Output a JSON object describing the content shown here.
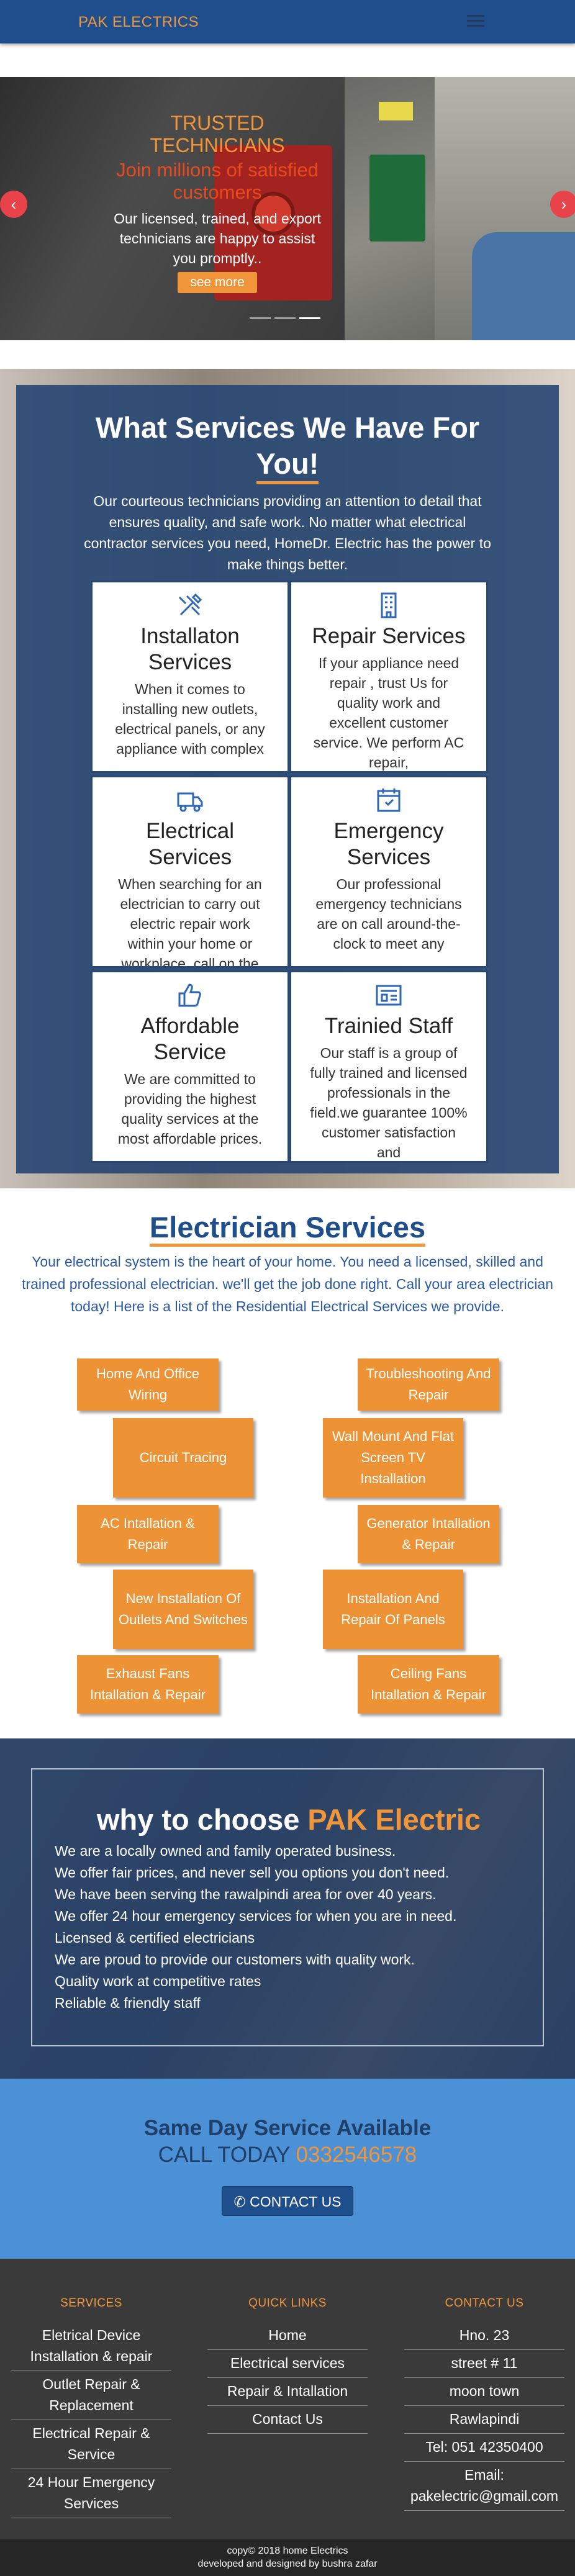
{
  "navbar": {
    "brand": "PAK ELECTRICS"
  },
  "hero": {
    "title": "TRUSTED TECHNICIANS",
    "subtitle": "Join millions of satisfied customers",
    "text": "Our licensed, trained, and export technicians are happy to assist you promptly..",
    "button": "see more",
    "arrow_left": "‹",
    "arrow_right": "›",
    "slides_count": 3,
    "active_slide": 3
  },
  "services": {
    "title_line1": "What Services We Have For",
    "title_line2": "You!",
    "description": "Our courteous technicians providing an attention to detail that ensures quality, and safe work. No matter what electrical contractor services you need, HomeDr. Electric has the power to make things better.",
    "cards": [
      {
        "icon": "hammer-wrench-icon",
        "title": "Installaton Services",
        "text": "When it comes to installing new outlets, electrical panels, or any appliance with complex"
      },
      {
        "icon": "building-icon",
        "title": "Repair Services",
        "text": "If your appliance need repair , trust Us for quality work and excellent customer service. We perform AC repair,"
      },
      {
        "icon": "truck-icon",
        "title": "Electrical Services",
        "text": "When searching for an electrician to carry out electric repair work within your home or workplace, call on the trusted"
      },
      {
        "icon": "calendar-icon",
        "title": "Emergency Services",
        "text": "Our professional emergency technicians are on call around-the-clock to meet any"
      },
      {
        "icon": "thumbs-up-icon",
        "title": "Affordable Service",
        "text": "We are committed to providing the highest quality services at the most affordable prices."
      },
      {
        "icon": "id-card-icon",
        "title": "Trainied Staff",
        "text": "Our staff is a group of fully trained and licensed professionals in the field.we guarantee 100% customer satisfaction and"
      }
    ]
  },
  "electrician": {
    "title": "Electrician Services",
    "description": "Your electrical system is the heart of your home. You need a licensed, skilled and trained professional electrician. we'll get the job done right. Call your area electrician today! Here is a list of the Residential Electrical Services we provide.",
    "buttons": [
      "Home And Office Wiring",
      "Troubleshooting And Repair",
      "Circuit Tracing",
      "Wall Mount And Flat Screen TV Installation",
      "AC Intallation & Repair",
      "Generator Intallation & Repair",
      "New Installation Of Outlets And Switches",
      "Installation And Repair Of Panels",
      "Exhaust Fans Intallation & Repair",
      "Ceiling Fans Intallation & Repair"
    ]
  },
  "why": {
    "title_prefix": "why to choose",
    "title_accent": "PAK Electric",
    "items": [
      "We are a locally owned and family operated business.",
      "We offer fair prices, and never sell you options you don't need.",
      "We have been serving the rawalpindi area for over 40 years.",
      "We offer 24 hour emergency services for when you are in need.",
      "Licensed & certified electricians",
      "We are proud to provide our customers with quality work.",
      "Quality work at competitive rates",
      "Reliable & friendly staff"
    ]
  },
  "sameday": {
    "title": "Same Day Service Available",
    "call_prefix": "CALL TODAY",
    "phone": "0332546578",
    "button": "CONTACT US"
  },
  "footer": {
    "services_heading": "SERVICES",
    "services": [
      "Eletrical Device Installation & repair",
      "Outlet Repair & Replacement",
      "Electrical Repair & Service",
      "24 Hour Emergency Services"
    ],
    "links_heading": "QUICK LINKS",
    "links": [
      "Home",
      "Electrical services",
      "Repair & Intallation",
      "Contact Us"
    ],
    "contact_heading": "CONTACT US",
    "contact": [
      "Hno. 23",
      "street # 11",
      "moon town",
      "Rawlapindi",
      "Tel: 051 42350400",
      "Email: pakelectric@gmail.com"
    ],
    "copyright": "copy© 2018 home Electrics",
    "credit": "developed and designed by bushra zafar"
  }
}
